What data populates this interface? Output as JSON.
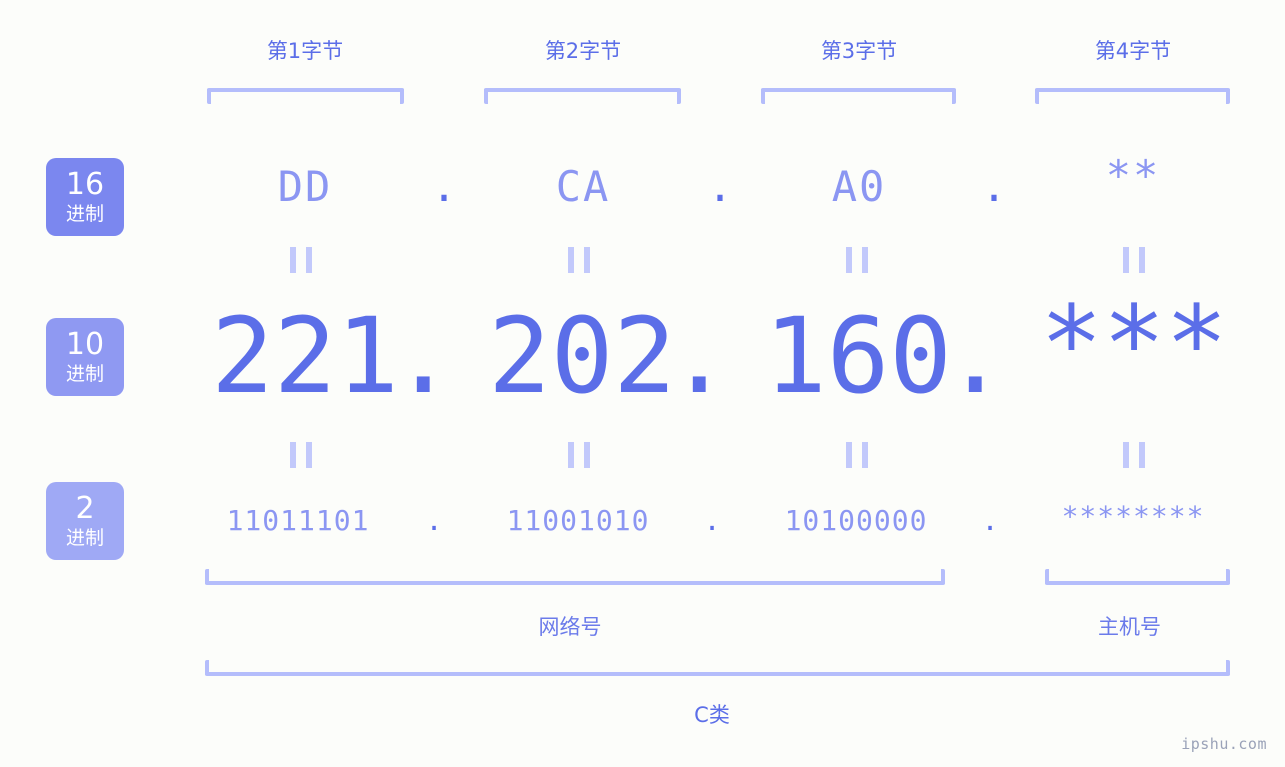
{
  "background_color": "#fcfdfa",
  "accent_color": "#5b6ee8",
  "accent_light_color": "#8b96f2",
  "bracket_color": "#b4bdfb",
  "byte_headers": [
    {
      "label": "第1字节"
    },
    {
      "label": "第2字节"
    },
    {
      "label": "第3字节"
    },
    {
      "label": "第4字节"
    }
  ],
  "radix_badges": [
    {
      "number": "16",
      "system": "进制",
      "color": "#7b87ef"
    },
    {
      "number": "10",
      "system": "进制",
      "color": "#8f99f2"
    },
    {
      "number": "2",
      "system": "进制",
      "color": "#9fa9f5"
    }
  ],
  "rows": {
    "hex": {
      "radix": "16",
      "values": [
        "DD",
        "CA",
        "A0",
        "**"
      ],
      "separator": "."
    },
    "decimal": {
      "radix": "10",
      "values": [
        "221",
        "202",
        "160",
        "***"
      ],
      "separator": "."
    },
    "binary": {
      "radix": "2",
      "values": [
        "11011101",
        "11001010",
        "10100000",
        "********"
      ],
      "separator": "."
    }
  },
  "equality_symbol": "||",
  "sections": {
    "network": {
      "label": "网络号"
    },
    "host": {
      "label": "主机号"
    },
    "class": {
      "label": "C类"
    }
  },
  "watermark": "ipshu.com"
}
